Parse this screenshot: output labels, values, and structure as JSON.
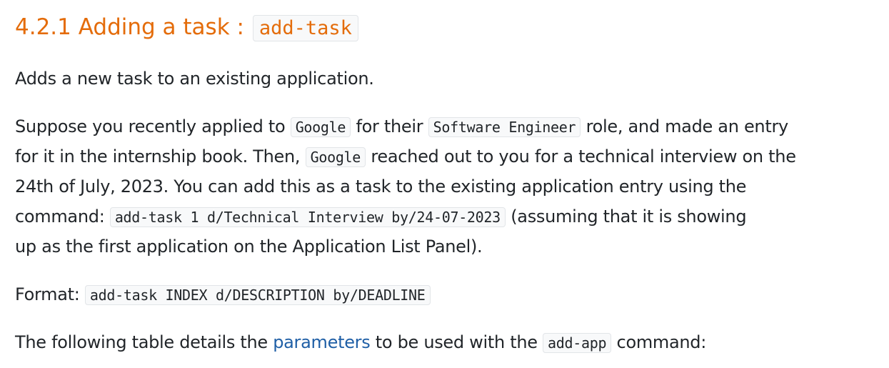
{
  "heading": {
    "text": "4.2.1 Adding a task : ",
    "code": "add-task"
  },
  "intro": "Adds a new task to an existing application.",
  "example": {
    "line1_a": "Suppose you recently applied to ",
    "code_company": "Google",
    "line1_b": " for their ",
    "code_role": "Software Engineer",
    "line1_c": " role, and made an entry",
    "line2_a": "for it in the internship book. Then, ",
    "code_company2": "Google",
    "line2_b": " reached out to you for a technical interview on the",
    "line3": "24th of July, 2023. You can add this as a task to the existing application entry using the",
    "line4_a": "command: ",
    "code_command": "add-task 1 d/Technical Interview by/24-07-2023",
    "line4_b": " (assuming that it is showing",
    "line5": "up as the first application on the Application List Panel)."
  },
  "format": {
    "label": "Format: ",
    "code": "add-task INDEX d/DESCRIPTION by/DEADLINE"
  },
  "table_note": {
    "before": "The following table details the ",
    "link": "parameters",
    "middle": " to be used with the ",
    "code": "add-app",
    "after": " command:"
  }
}
